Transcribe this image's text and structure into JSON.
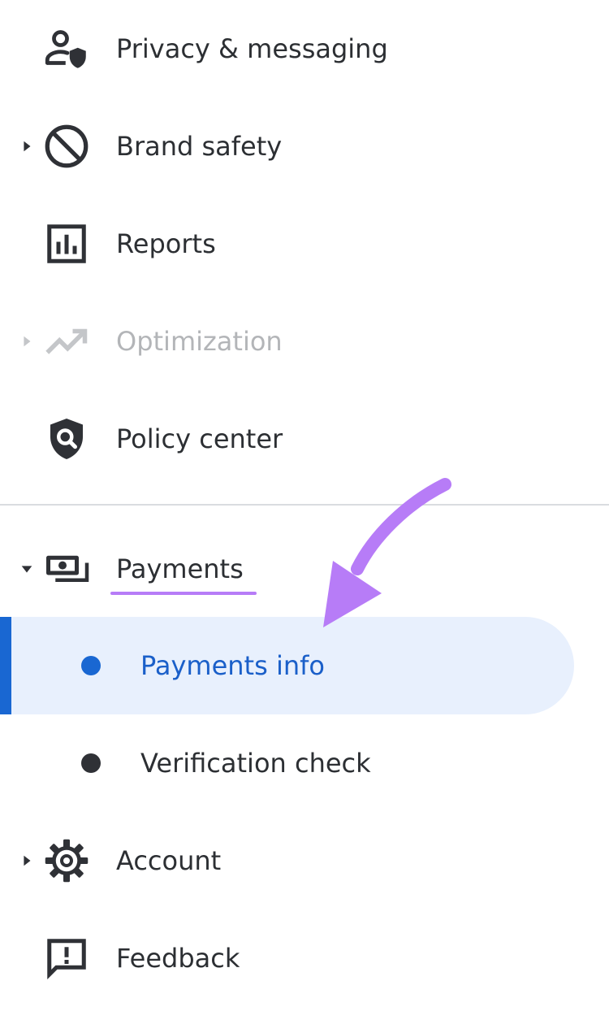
{
  "nav": {
    "privacy": {
      "label": "Privacy & messaging",
      "icon": "person-shield-icon"
    },
    "brand_safety": {
      "label": "Brand safety",
      "icon": "block-icon",
      "expandable": true
    },
    "reports": {
      "label": "Reports",
      "icon": "bar-chart-icon"
    },
    "optimization": {
      "label": "Optimization",
      "icon": "trending-up-icon",
      "expandable": true,
      "disabled": true
    },
    "policy_center": {
      "label": "Policy center",
      "icon": "shield-search-icon"
    },
    "payments": {
      "label": "Payments",
      "icon": "money-icon",
      "expanded": true,
      "children": [
        {
          "label": "Payments info",
          "active": true
        },
        {
          "label": "Verification check",
          "active": false
        }
      ]
    },
    "account": {
      "label": "Account",
      "icon": "gear-icon",
      "expandable": true
    },
    "feedback": {
      "label": "Feedback",
      "icon": "feedback-icon"
    }
  },
  "colors": {
    "text": "#2c2f33",
    "disabled_text": "#b3b5b8",
    "active_text": "#1a5fc9",
    "active_bar": "#1967d2",
    "active_bg": "#e8f0fd",
    "annotation": "#b77cf7",
    "divider": "#dadce0"
  }
}
